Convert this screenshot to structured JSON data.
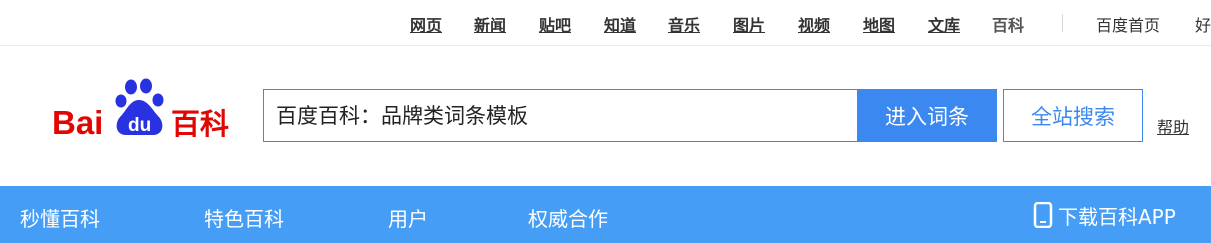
{
  "top_nav": {
    "items": [
      {
        "label": "网页"
      },
      {
        "label": "新闻"
      },
      {
        "label": "贴吧"
      },
      {
        "label": "知道"
      },
      {
        "label": "音乐"
      },
      {
        "label": "图片"
      },
      {
        "label": "视频"
      },
      {
        "label": "地图"
      },
      {
        "label": "文库"
      },
      {
        "label": "百科"
      }
    ],
    "right_links": [
      "百度首页",
      "好"
    ]
  },
  "logo": {
    "text_main": "Bai",
    "text_du": "du",
    "text_cn": "百科"
  },
  "search": {
    "value": "百度百科：品牌类词条模板",
    "enter_button": "进入词条",
    "site_search_button": "全站搜索",
    "help": "帮助"
  },
  "blue_nav": {
    "items": [
      "秒懂百科",
      "特色百科",
      "用户",
      "权威合作"
    ],
    "app_label": "下载百科APP",
    "app_icon": "phone-icon"
  },
  "colors": {
    "accent": "#3a88f0",
    "bar": "#459df5",
    "logo_red": "#e10602",
    "logo_blue": "#2932e1"
  }
}
